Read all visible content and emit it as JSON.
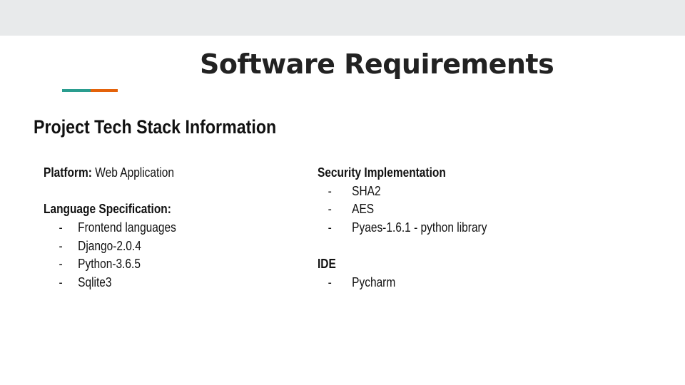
{
  "slide": {
    "title": "Software Requirements",
    "subtitle": "Project Tech Stack Information",
    "accent_colors": [
      "#2a9d8f",
      "#e4620a"
    ]
  },
  "left_column": {
    "platform_label": "Platform:",
    "platform_value": "Web Application",
    "language_label": "Language  Specification:",
    "language_items": [
      "Frontend languages",
      "Django-2.0.4",
      "Python-3.6.5",
      "Sqlite3"
    ]
  },
  "right_column": {
    "security_label": "Security  Implementation",
    "security_items": [
      "SHA2",
      "AES",
      "Pyaes-1.6.1  - python library"
    ],
    "ide_label": "IDE",
    "ide_items": [
      "Pycharm"
    ]
  },
  "bullet_glyph": "-"
}
